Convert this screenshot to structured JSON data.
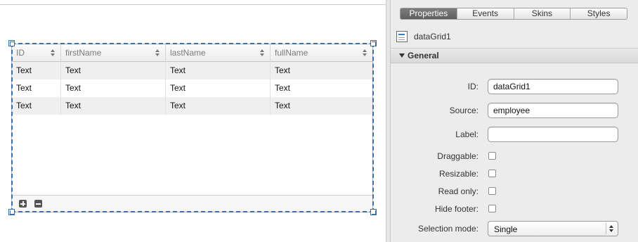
{
  "canvas": {
    "grid": {
      "columns": [
        "ID",
        "firstName",
        "lastName",
        "fullName"
      ],
      "rows": [
        [
          "Text",
          "Text",
          "Text",
          "Text"
        ],
        [
          "Text",
          "Text",
          "Text",
          "Text"
        ],
        [
          "Text",
          "Text",
          "Text",
          "Text"
        ]
      ],
      "footer_icons": [
        "add-row-icon",
        "remove-row-icon"
      ]
    },
    "selection_color": "#3c6ea8"
  },
  "panel": {
    "tabs": [
      {
        "label": "Properties",
        "active": true
      },
      {
        "label": "Events",
        "active": false
      },
      {
        "label": "Skins",
        "active": false
      },
      {
        "label": "Styles",
        "active": false
      }
    ],
    "component": {
      "icon": "datagrid-icon",
      "name": "dataGrid1"
    },
    "section": {
      "title": "General",
      "expanded": true
    },
    "fields": {
      "id": {
        "label": "ID:",
        "value": "dataGrid1"
      },
      "source": {
        "label": "Source:",
        "value": "employee"
      },
      "label": {
        "label": "Label:",
        "value": ""
      },
      "draggable": {
        "label": "Draggable:",
        "checked": false
      },
      "resizable": {
        "label": "Resizable:",
        "checked": false
      },
      "read_only": {
        "label": "Read only:",
        "checked": false
      },
      "hide_footer": {
        "label": "Hide footer:",
        "checked": false
      },
      "selection_mode": {
        "label": "Selection mode:",
        "value": "Single"
      }
    }
  }
}
